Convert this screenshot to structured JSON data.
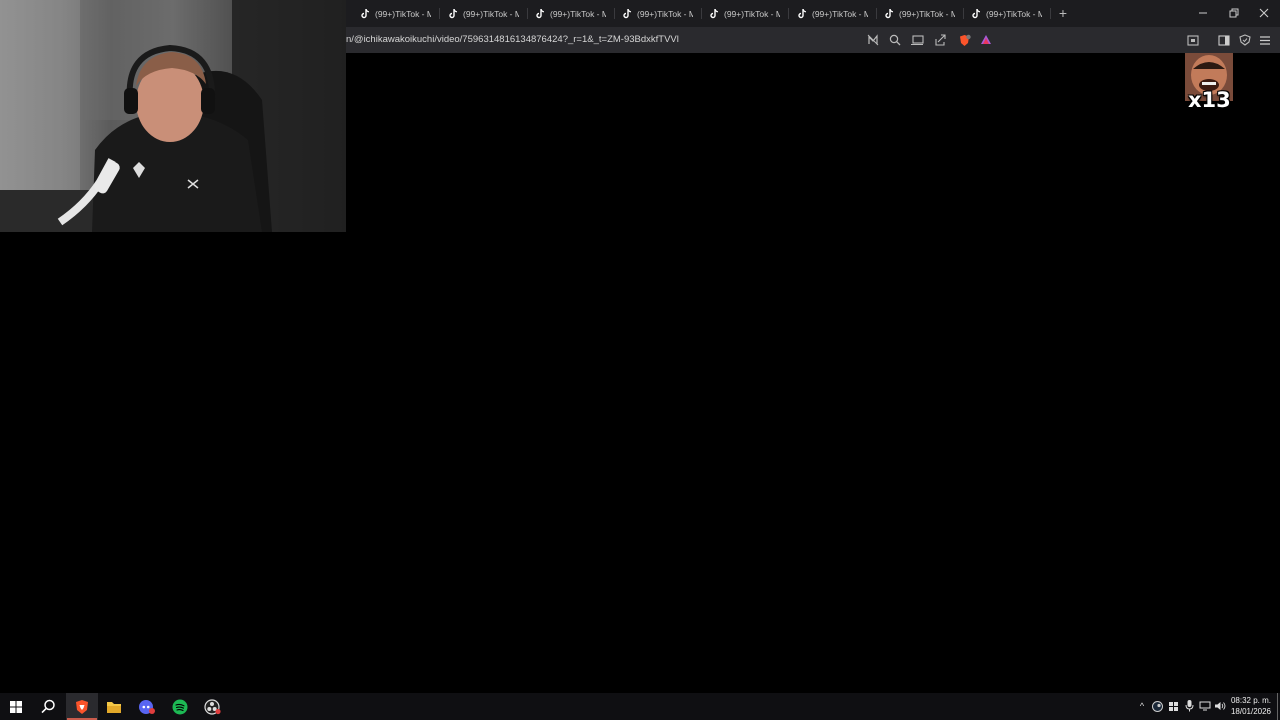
{
  "browser": {
    "tabs": [
      {
        "label": "(99+)TikTok - M"
      },
      {
        "label": "(99+)TikTok - M"
      },
      {
        "label": "(99+)TikTok - M"
      },
      {
        "label": "(99+)TikTok - M"
      },
      {
        "label": "(99+)TikTok - M"
      },
      {
        "label": "(99+)TikTok - M"
      },
      {
        "label": "(99+)TikTok - M"
      },
      {
        "label": "(99+)TikTok - M"
      }
    ],
    "new_tab_symbol": "+",
    "address": "n/@ichikawakoikuchi/video/7596314816134876424?_r=1&_t=ZM-93BdxkfTVVl",
    "toolbar_icons": [
      "reader-mode-off-icon",
      "zoom-icon",
      "cast-icon",
      "share-icon",
      "brave-shields-icon",
      "brave-rewards-icon"
    ],
    "right_icons": [
      "screenshot-icon",
      "sidebar-icon",
      "vpn-icon",
      "menu-icon"
    ]
  },
  "overlay": {
    "emote_count": "x13"
  },
  "taskbar": {
    "apps": [
      "start-icon",
      "search-icon",
      "brave-browser-icon",
      "file-explorer-icon",
      "discord-icon",
      "spotify-icon",
      "obs-icon"
    ],
    "tray_chevron": "^",
    "clock": {
      "time": "08:32 p. m.",
      "date": "18/01/2026"
    }
  },
  "colors": {
    "accent_brave": "#fb542b",
    "spotify": "#1db954",
    "taskbar_bg": "#0f0f12",
    "tabstrip_bg": "#1c1c1f"
  }
}
